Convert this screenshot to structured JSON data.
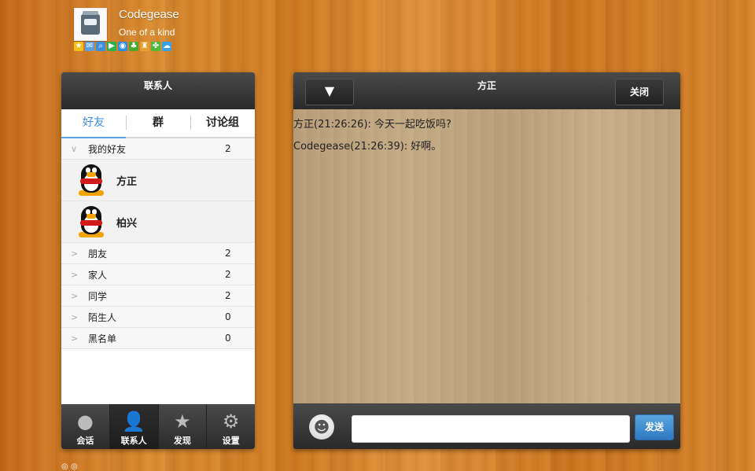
{
  "profile": {
    "name": "Codegease",
    "signature": "One of a kind",
    "status_icons": [
      {
        "icon": "star-icon",
        "glyph": "★",
        "color": "#f5c01a"
      },
      {
        "icon": "mail-icon",
        "glyph": "✉",
        "color": "#5aa0e0"
      },
      {
        "icon": "search-icon",
        "glyph": "⌕",
        "color": "#3c8fd8"
      },
      {
        "icon": "play-icon",
        "glyph": "▶",
        "color": "#2cb24c"
      },
      {
        "icon": "browser-icon",
        "glyph": "◉",
        "color": "#2d8ee0"
      },
      {
        "icon": "tree-icon",
        "glyph": "♣",
        "color": "#49a832"
      },
      {
        "icon": "bag-icon",
        "glyph": "♜",
        "color": "#e6a032"
      },
      {
        "icon": "leaf-icon",
        "glyph": "✤",
        "color": "#4cba3a"
      },
      {
        "icon": "cloud-icon",
        "glyph": "☁",
        "color": "#36a2e8"
      }
    ]
  },
  "contacts": {
    "title": "联系人",
    "tabs": [
      {
        "label": "好友",
        "active": true
      },
      {
        "label": "群",
        "active": false
      },
      {
        "label": "讨论组",
        "active": false
      }
    ],
    "expanded_group": {
      "name": "我的好友",
      "count": "2",
      "chevron": "∨"
    },
    "friends": [
      {
        "name": "方正"
      },
      {
        "name": "柏兴"
      }
    ],
    "groups": [
      {
        "name": "朋友",
        "count": "2",
        "chevron": ">"
      },
      {
        "name": "家人",
        "count": "2",
        "chevron": ">"
      },
      {
        "name": "同学",
        "count": "2",
        "chevron": ">"
      },
      {
        "name": "陌生人",
        "count": "0",
        "chevron": ">"
      },
      {
        "name": "黑名单",
        "count": "0",
        "chevron": ">"
      }
    ],
    "nav": [
      {
        "label": "会话",
        "icon": "chat-bubble-icon",
        "glyph": "●",
        "active": false
      },
      {
        "label": "联系人",
        "icon": "contacts-person-icon",
        "glyph": "👤",
        "active": true
      },
      {
        "label": "发现",
        "icon": "discover-star-icon",
        "glyph": "★",
        "active": false
      },
      {
        "label": "设置",
        "icon": "settings-gear-icon",
        "glyph": "⚙",
        "active": false
      }
    ]
  },
  "chat": {
    "title": "方正",
    "dropdown_glyph": "▼",
    "close_label": "关闭",
    "messages": [
      {
        "text": "方正(21:26:26): 今天一起吃饭吗?"
      },
      {
        "text": "Codegease(21:26:39): 好啊。"
      }
    ],
    "input_value": "",
    "send_label": "发送",
    "emoji_glyph": "☻"
  },
  "footer": {
    "dots": "◎ ◎"
  }
}
